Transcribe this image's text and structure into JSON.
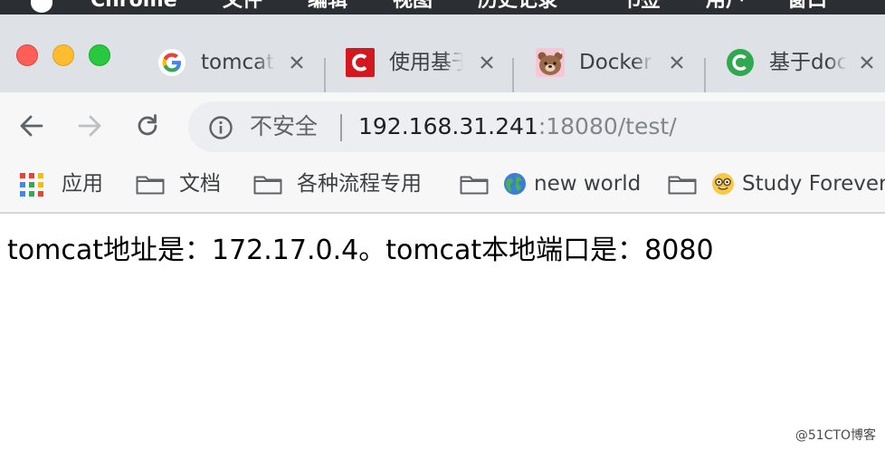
{
  "menubar": {
    "app_name": "Chrome",
    "items": [
      "文件",
      "编辑",
      "视图",
      "历史记录",
      "书签",
      "用户",
      "窗口"
    ]
  },
  "tabs": [
    {
      "title": "tomcat",
      "favicon": "google-g-icon"
    },
    {
      "title": "使用基于",
      "favicon": "red-c-logo-icon"
    },
    {
      "title": "Docker",
      "favicon": "brown-bear-icon"
    },
    {
      "title": "基于doc",
      "favicon": "green-c-logo-icon"
    }
  ],
  "toolbar": {
    "security_label": "不安全",
    "url_host": "192.168.31.241",
    "url_rest": ":18080/test/"
  },
  "bookmarks": [
    {
      "label": "应用",
      "icon": "apps-grid-icon"
    },
    {
      "label": "文档",
      "icon": "folder-icon"
    },
    {
      "label": "各种流程专用",
      "icon": "folder-icon"
    },
    {
      "label": "new world",
      "icon": "globe-icon"
    },
    {
      "label": "Study Forever",
      "icon": "nerd-face-icon"
    }
  ],
  "page": {
    "message": "tomcat地址是：172.17.0.4。tomcat本地端口是：8080"
  },
  "watermark": "@51CTO博客",
  "colors": {
    "tabstrip_bg": "#dee1e6",
    "toolbar_bg": "#f7f7f7",
    "omnibox_bg": "#eceef1",
    "close_red": "#fe5f57",
    "minimize_yellow": "#febc2e",
    "maximize_green": "#28c840"
  }
}
